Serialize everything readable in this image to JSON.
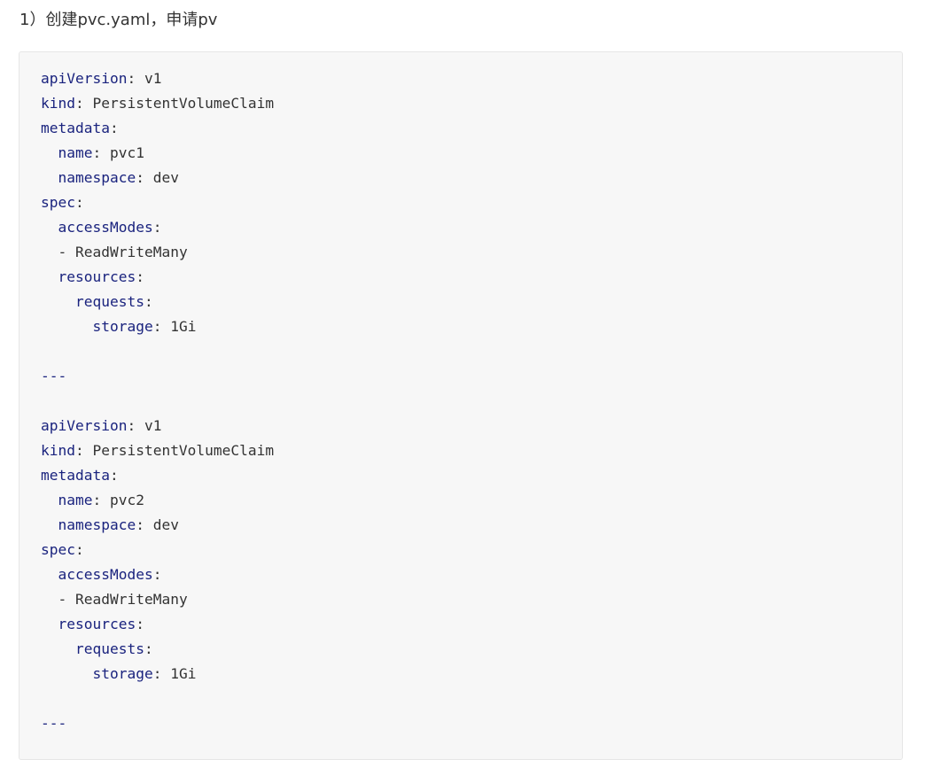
{
  "heading": "1）创建pvc.yaml，申请pv",
  "code": {
    "lines": [
      {
        "indent": "",
        "dash": "",
        "key": "apiVersion",
        "colon": ":",
        "value": " v1"
      },
      {
        "indent": "",
        "dash": "",
        "key": "kind",
        "colon": ":",
        "value": " PersistentVolumeClaim"
      },
      {
        "indent": "",
        "dash": "",
        "key": "metadata",
        "colon": ":",
        "value": ""
      },
      {
        "indent": "  ",
        "dash": "",
        "key": "name",
        "colon": ":",
        "value": " pvc1"
      },
      {
        "indent": "  ",
        "dash": "",
        "key": "namespace",
        "colon": ":",
        "value": " dev"
      },
      {
        "indent": "",
        "dash": "",
        "key": "spec",
        "colon": ":",
        "value": ""
      },
      {
        "indent": "  ",
        "dash": "",
        "key": "accessModes",
        "colon": ":",
        "value": ""
      },
      {
        "indent": "  ",
        "dash": "- ",
        "key": "",
        "colon": "",
        "value": "ReadWriteMany"
      },
      {
        "indent": "  ",
        "dash": "",
        "key": "resources",
        "colon": ":",
        "value": ""
      },
      {
        "indent": "    ",
        "dash": "",
        "key": "requests",
        "colon": ":",
        "value": ""
      },
      {
        "indent": "      ",
        "dash": "",
        "key": "storage",
        "colon": ":",
        "value": " 1Gi"
      },
      {
        "indent": "",
        "dash": "",
        "key": "",
        "colon": "",
        "value": ""
      },
      {
        "indent": "",
        "dash": "",
        "key": "---",
        "colon": "",
        "value": ""
      },
      {
        "indent": "",
        "dash": "",
        "key": "",
        "colon": "",
        "value": ""
      },
      {
        "indent": "",
        "dash": "",
        "key": "apiVersion",
        "colon": ":",
        "value": " v1"
      },
      {
        "indent": "",
        "dash": "",
        "key": "kind",
        "colon": ":",
        "value": " PersistentVolumeClaim"
      },
      {
        "indent": "",
        "dash": "",
        "key": "metadata",
        "colon": ":",
        "value": ""
      },
      {
        "indent": "  ",
        "dash": "",
        "key": "name",
        "colon": ":",
        "value": " pvc2"
      },
      {
        "indent": "  ",
        "dash": "",
        "key": "namespace",
        "colon": ":",
        "value": " dev"
      },
      {
        "indent": "",
        "dash": "",
        "key": "spec",
        "colon": ":",
        "value": ""
      },
      {
        "indent": "  ",
        "dash": "",
        "key": "accessModes",
        "colon": ":",
        "value": ""
      },
      {
        "indent": "  ",
        "dash": "- ",
        "key": "",
        "colon": "",
        "value": "ReadWriteMany"
      },
      {
        "indent": "  ",
        "dash": "",
        "key": "resources",
        "colon": ":",
        "value": ""
      },
      {
        "indent": "    ",
        "dash": "",
        "key": "requests",
        "colon": ":",
        "value": ""
      },
      {
        "indent": "      ",
        "dash": "",
        "key": "storage",
        "colon": ":",
        "value": " 1Gi"
      },
      {
        "indent": "",
        "dash": "",
        "key": "",
        "colon": "",
        "value": ""
      },
      {
        "indent": "",
        "dash": "",
        "key": "---",
        "colon": "",
        "value": ""
      }
    ]
  },
  "colors": {
    "key": "#1a237e",
    "text": "#333333",
    "code_background": "#f7f7f7"
  }
}
